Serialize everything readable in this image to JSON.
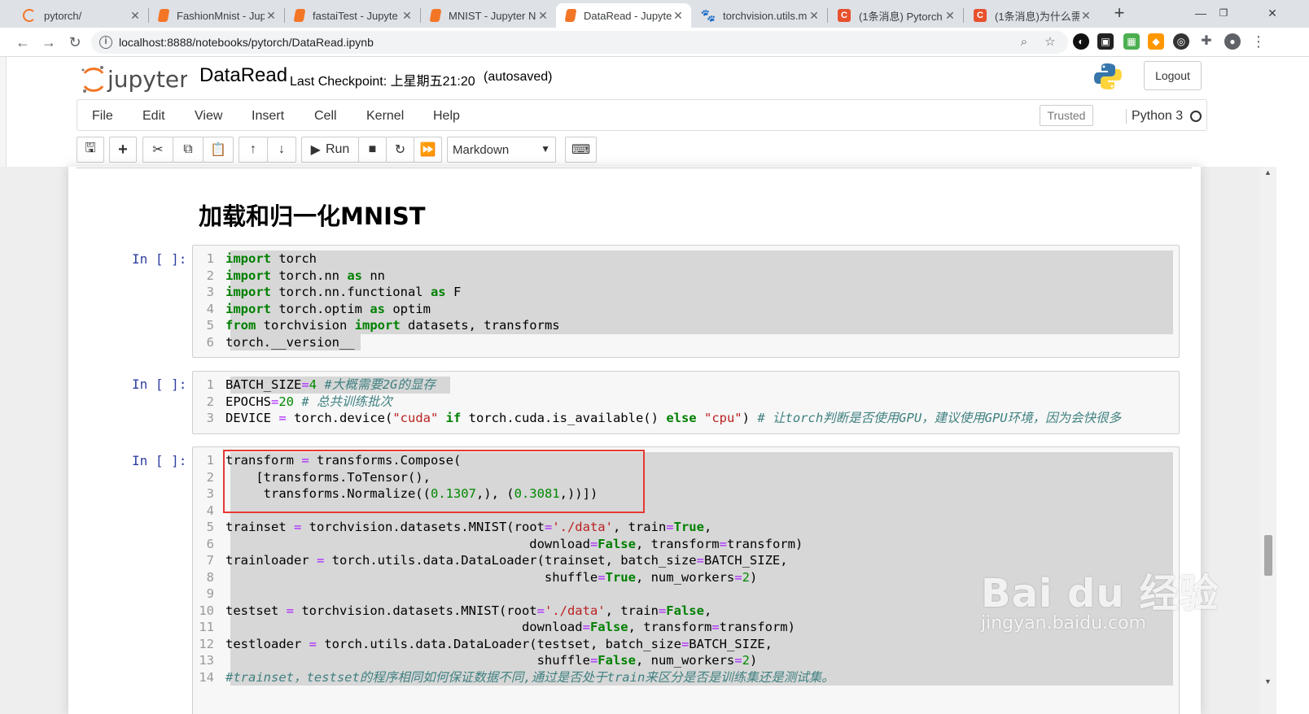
{
  "browser": {
    "tabs": [
      {
        "title": "pytorch/",
        "favicon": "jupyter-icon",
        "color": "#f37626"
      },
      {
        "title": "FashionMnist - Jup",
        "favicon": "notebook-icon",
        "color": "#f37626"
      },
      {
        "title": "fastaiTest - Jupyte",
        "favicon": "notebook-icon",
        "color": "#f37626"
      },
      {
        "title": "MNIST - Jupyter N",
        "favicon": "notebook-icon",
        "color": "#f37626"
      },
      {
        "title": "DataRead - Jupyte",
        "favicon": "notebook-icon",
        "color": "#f37626",
        "active": true
      },
      {
        "title": "torchvision.utils.m",
        "favicon": "paw-icon",
        "color": "#2932e1"
      },
      {
        "title": "(1条消息) Pytorch",
        "favicon": "csdn-icon",
        "color": "#e8512d"
      },
      {
        "title": "(1条消息)为什么需",
        "favicon": "csdn-icon",
        "color": "#e8512d"
      }
    ],
    "url": "localhost:8888/notebooks/pytorch/DataRead.ipynb"
  },
  "jupyter": {
    "logo_text": "jupyter",
    "notebook_name": "DataRead",
    "checkpoint": "Last Checkpoint: 上星期五21:20",
    "autosave": "(autosaved)",
    "logout": "Logout",
    "menu": [
      "File",
      "Edit",
      "View",
      "Insert",
      "Cell",
      "Kernel",
      "Help"
    ],
    "trusted": "Trusted",
    "kernel": "Python 3",
    "toolbar": {
      "run_label": "Run",
      "cell_type": "Markdown"
    }
  },
  "notebook": {
    "heading": "加载和归一化MNIST",
    "prompt": "In [ ]:",
    "cells": [
      {
        "lines": [
          [
            [
              "k",
              "import"
            ],
            [
              "t",
              " torch"
            ]
          ],
          [
            [
              "k",
              "import"
            ],
            [
              "t",
              " torch.nn "
            ],
            [
              "k",
              "as"
            ],
            [
              "t",
              " nn"
            ]
          ],
          [
            [
              "k",
              "import"
            ],
            [
              "t",
              " torch.nn.functional "
            ],
            [
              "k",
              "as"
            ],
            [
              "t",
              " F"
            ]
          ],
          [
            [
              "k",
              "import"
            ],
            [
              "t",
              " torch.optim "
            ],
            [
              "k",
              "as"
            ],
            [
              "t",
              " optim"
            ]
          ],
          [
            [
              "k",
              "from"
            ],
            [
              "t",
              " torchvision "
            ],
            [
              "k",
              "import"
            ],
            [
              "t",
              " datasets, transforms"
            ]
          ],
          [
            [
              "t",
              "torch.__version__"
            ]
          ]
        ]
      },
      {
        "lines": [
          [
            [
              "t",
              "BATCH_SIZE"
            ],
            [
              "o",
              "="
            ],
            [
              "n",
              "4"
            ],
            [
              "t",
              " "
            ],
            [
              "c",
              "#大概需要2G的显存"
            ]
          ],
          [
            [
              "t",
              "EPOCHS"
            ],
            [
              "o",
              "="
            ],
            [
              "n",
              "20"
            ],
            [
              "t",
              " "
            ],
            [
              "c",
              "# 总共训练批次"
            ]
          ],
          [
            [
              "t",
              "DEVICE "
            ],
            [
              "o",
              "="
            ],
            [
              "t",
              " torch.device("
            ],
            [
              "s",
              "\"cuda\""
            ],
            [
              "t",
              " "
            ],
            [
              "k",
              "if"
            ],
            [
              "t",
              " torch.cuda.is_available() "
            ],
            [
              "k",
              "else"
            ],
            [
              "t",
              " "
            ],
            [
              "s",
              "\"cpu\""
            ],
            [
              "t",
              ") "
            ],
            [
              "c",
              "# 让torch判断是否使用GPU，建议使用GPU环境，因为会快很多"
            ]
          ]
        ]
      },
      {
        "lines": [
          [
            [
              "t",
              "transform "
            ],
            [
              "o",
              "="
            ],
            [
              "t",
              " transforms.Compose("
            ]
          ],
          [
            [
              "t",
              "    [transforms.ToTensor(),"
            ]
          ],
          [
            [
              "t",
              "     transforms.Normalize(("
            ],
            [
              "n",
              "0.1307"
            ],
            [
              "t",
              ",), ("
            ],
            [
              "n",
              "0.3081"
            ],
            [
              "t",
              ",))])"
            ]
          ],
          [
            [
              "t",
              ""
            ]
          ],
          [
            [
              "t",
              "trainset "
            ],
            [
              "o",
              "="
            ],
            [
              "t",
              " torchvision.datasets.MNIST(root"
            ],
            [
              "o",
              "="
            ],
            [
              "s",
              "'./data'"
            ],
            [
              "t",
              ", train"
            ],
            [
              "o",
              "="
            ],
            [
              "k",
              "True"
            ],
            [
              "t",
              ","
            ]
          ],
          [
            [
              "t",
              "                                        download"
            ],
            [
              "o",
              "="
            ],
            [
              "k",
              "False"
            ],
            [
              "t",
              ", transform"
            ],
            [
              "o",
              "="
            ],
            [
              "t",
              "transform)"
            ]
          ],
          [
            [
              "t",
              "trainloader "
            ],
            [
              "o",
              "="
            ],
            [
              "t",
              " torch.utils.data.DataLoader(trainset, batch_size"
            ],
            [
              "o",
              "="
            ],
            [
              "t",
              "BATCH_SIZE,"
            ]
          ],
          [
            [
              "t",
              "                                          shuffle"
            ],
            [
              "o",
              "="
            ],
            [
              "k",
              "True"
            ],
            [
              "t",
              ", num_workers"
            ],
            [
              "o",
              "="
            ],
            [
              "n",
              "2"
            ],
            [
              "t",
              ")"
            ]
          ],
          [
            [
              "t",
              ""
            ]
          ],
          [
            [
              "t",
              "testset "
            ],
            [
              "o",
              "="
            ],
            [
              "t",
              " torchvision.datasets.MNIST(root"
            ],
            [
              "o",
              "="
            ],
            [
              "s",
              "'./data'"
            ],
            [
              "t",
              ", train"
            ],
            [
              "o",
              "="
            ],
            [
              "k",
              "False"
            ],
            [
              "t",
              ","
            ]
          ],
          [
            [
              "t",
              "                                       download"
            ],
            [
              "o",
              "="
            ],
            [
              "k",
              "False"
            ],
            [
              "t",
              ", transform"
            ],
            [
              "o",
              "="
            ],
            [
              "t",
              "transform)"
            ]
          ],
          [
            [
              "t",
              "testloader "
            ],
            [
              "o",
              "="
            ],
            [
              "t",
              " torch.utils.data.DataLoader(testset, batch_size"
            ],
            [
              "o",
              "="
            ],
            [
              "t",
              "BATCH_SIZE,"
            ]
          ],
          [
            [
              "t",
              "                                         shuffle"
            ],
            [
              "o",
              "="
            ],
            [
              "k",
              "False"
            ],
            [
              "t",
              ", num_workers"
            ],
            [
              "o",
              "="
            ],
            [
              "n",
              "2"
            ],
            [
              "t",
              ")"
            ]
          ],
          [
            [
              "c",
              "#trainset，testset的程序相同如何保证数据不同,通过是否处于train来区分是否是训练集还是测试集。"
            ]
          ]
        ]
      }
    ]
  },
  "watermark": {
    "brand": "Bai du 经验",
    "url": "jingyan.baidu.com"
  }
}
